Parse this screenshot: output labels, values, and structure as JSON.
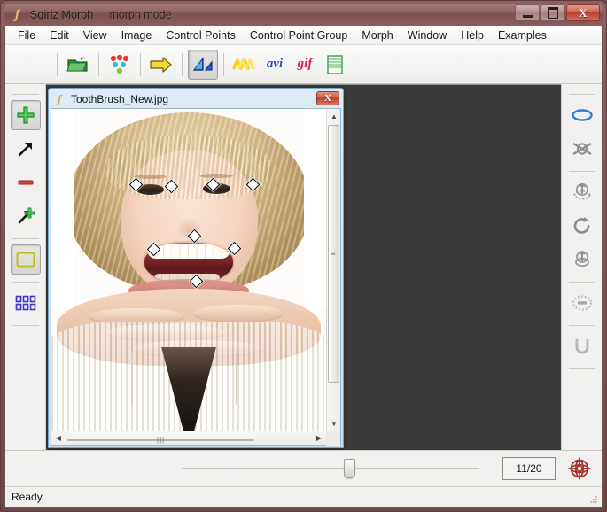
{
  "app": {
    "title": "Sqirlz Morph",
    "mode": "morph mode",
    "icon": "sqirlz-logo-icon"
  },
  "window_controls": {
    "minimize": "minimize-icon",
    "maximize": "maximize-icon",
    "close": "X"
  },
  "menubar": {
    "items": [
      {
        "label": "File"
      },
      {
        "label": "Edit"
      },
      {
        "label": "View"
      },
      {
        "label": "Image"
      },
      {
        "label": "Control Points"
      },
      {
        "label": "Control Point Group"
      },
      {
        "label": "Morph"
      },
      {
        "label": "Window"
      },
      {
        "label": "Help"
      },
      {
        "label": "Examples"
      }
    ]
  },
  "toolbar": {
    "buttons": [
      {
        "name": "open-folder-icon",
        "label": "",
        "pressed": false
      },
      {
        "name": "control-points-icon",
        "label": "",
        "pressed": false
      },
      {
        "name": "arrow-right-icon",
        "label": "",
        "pressed": false
      },
      {
        "name": "morph-triangles-icon",
        "label": "",
        "pressed": true
      },
      {
        "name": "warp-waves-icon",
        "label": "",
        "pressed": false
      },
      {
        "name": "avi-export-icon",
        "label": "avi",
        "pressed": false
      },
      {
        "name": "gif-export-icon",
        "label": "gif",
        "pressed": false
      },
      {
        "name": "filmstrip-icon",
        "label": "",
        "pressed": false
      }
    ]
  },
  "left_tools": {
    "items": [
      {
        "name": "add-point-tool",
        "pressed": true
      },
      {
        "name": "move-point-tool",
        "pressed": false
      },
      {
        "name": "delete-point-tool",
        "pressed": false
      },
      {
        "name": "move-all-points-tool",
        "pressed": false
      },
      {
        "name": "rectangle-select-tool",
        "pressed": true
      },
      {
        "name": "grid-points-tool",
        "pressed": false
      }
    ]
  },
  "right_tools": {
    "items": [
      {
        "name": "ellipse-select-icon",
        "pressed": false
      },
      {
        "name": "ellipse-crossed-icon",
        "pressed": false
      },
      {
        "name": "flip-vertical-icon",
        "pressed": false
      },
      {
        "name": "rotate-clockwise-icon",
        "pressed": false
      },
      {
        "name": "flip-up-icon",
        "pressed": false
      },
      {
        "name": "dashed-ellipse-icon",
        "pressed": false
      },
      {
        "name": "undo-u-icon",
        "pressed": false
      }
    ]
  },
  "document_window": {
    "title": "ToothBrush_New.jpg",
    "close_label": "X",
    "icon": "sqirlz-doc-icon",
    "control_points": [
      {
        "x": 30.5,
        "y": 23.4
      },
      {
        "x": 43.5,
        "y": 23.8
      },
      {
        "x": 58.5,
        "y": 23.2
      },
      {
        "x": 73.0,
        "y": 23.3
      },
      {
        "x": 51.8,
        "y": 39.2
      },
      {
        "x": 36.8,
        "y": 43.5
      },
      {
        "x": 66.2,
        "y": 43.2
      },
      {
        "x": 52.3,
        "y": 53.2
      }
    ],
    "vscroll": {
      "up": "scroll-up-arrow",
      "down": "scroll-down-arrow"
    },
    "hscroll": {
      "left": "scroll-left-arrow",
      "right": "scroll-right-arrow"
    }
  },
  "bottom": {
    "frame_counter": "11/20",
    "slider_position_percent": 54,
    "globe_icon": "morph-globe-icon"
  },
  "statusbar": {
    "text": "Ready"
  },
  "colors": {
    "title_bar": "#8d5d5e",
    "mdi_background": "#3b3b3b",
    "accent_red": "#bb3f2e",
    "panel": "#f1f0ee"
  }
}
